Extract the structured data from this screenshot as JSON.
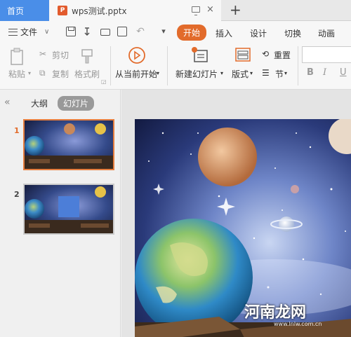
{
  "tabs": {
    "home": "首页",
    "doc_name": "wps测试.pptx",
    "doc_badge": "P",
    "close": "×",
    "add": "+"
  },
  "toolbar": {
    "file_label": "文件",
    "undo": "↶",
    "redo_dropdown": "▾"
  },
  "ribbon_tabs": [
    "开始",
    "插入",
    "设计",
    "切换",
    "动画"
  ],
  "ribbon": {
    "paste": "粘贴",
    "cut": "剪切",
    "copy": "复制",
    "format_painter": "格式刷",
    "from_current": "从当前开始",
    "new_slide": "新建幻灯片",
    "layout": "版式",
    "reset": "重置",
    "section": "节",
    "bold": "B",
    "italic": "I",
    "underline": "U"
  },
  "panel": {
    "collapse": "«",
    "outline": "大纲",
    "slides": "幻灯片"
  },
  "thumbnails": [
    {
      "num": "1"
    },
    {
      "num": "2"
    }
  ],
  "watermark": {
    "main": "河南龙网",
    "sub": "www.lnlw.com.cn"
  },
  "colors": {
    "accent": "#e26b2b",
    "home_tab": "#4a8ee8"
  }
}
